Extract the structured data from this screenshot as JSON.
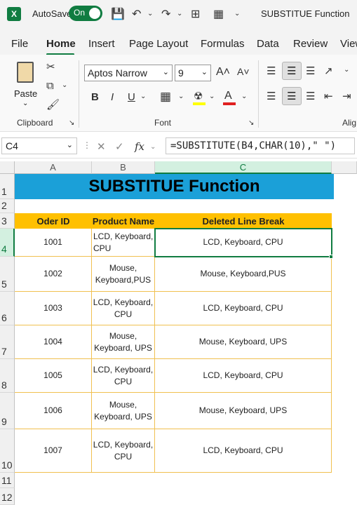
{
  "titlebar": {
    "app_icon": "X",
    "autosave_label": "AutoSave",
    "toggle_label": "On",
    "doc_title": "SUBSTITUE Function"
  },
  "tabs": [
    "File",
    "Home",
    "Insert",
    "Page Layout",
    "Formulas",
    "Data",
    "Review",
    "View"
  ],
  "ribbon": {
    "paste_label": "Paste",
    "clipboard_label": "Clipboard",
    "font_label": "Font",
    "alignment_label": "Alig",
    "font_name": "Aptos Narrow",
    "font_size": "9",
    "bold": "B",
    "italic": "I",
    "underline": "U",
    "grow_font": "A˄",
    "shrink_font": "A˅",
    "font_color": "A"
  },
  "formula_bar": {
    "name_box": "C4",
    "fx": "fx",
    "formula": "=SUBSTITUTE(B4,CHAR(10),\" \")"
  },
  "sheet": {
    "columns": [
      "A",
      "B",
      "C"
    ],
    "rows": [
      "1",
      "2",
      "3",
      "4",
      "5",
      "6",
      "7",
      "8",
      "9",
      "10",
      "11",
      "12"
    ],
    "title": "SUBSTITUE Function",
    "headers": [
      "Oder ID",
      "Product Name",
      "Deleted Line Break"
    ],
    "data": [
      {
        "id": "1001",
        "product": "LCD, Keyboard,\nCPU",
        "result": "LCD, Keyboard, CPU"
      },
      {
        "id": "1002",
        "product": "Mouse,\nKeyboard,PUS",
        "result": "Mouse, Keyboard,PUS"
      },
      {
        "id": "1003",
        "product": "LCD, Keyboard,\nCPU",
        "result": "LCD, Keyboard, CPU"
      },
      {
        "id": "1004",
        "product": "Mouse,\nKeyboard, UPS",
        "result": "Mouse, Keyboard, UPS"
      },
      {
        "id": "1005",
        "product": "LCD, Keyboard,\nCPU",
        "result": "LCD, Keyboard, CPU"
      },
      {
        "id": "1006",
        "product": "Mouse,\nKeyboard, UPS",
        "result": "Mouse, Keyboard, UPS"
      },
      {
        "id": "1007",
        "product": "LCD, Keyboard,\nCPU",
        "result": "LCD, Keyboard, CPU"
      }
    ]
  },
  "colors": {
    "excel_green": "#107c41",
    "title_fill": "#1ba0d8",
    "header_fill": "#ffc000"
  }
}
